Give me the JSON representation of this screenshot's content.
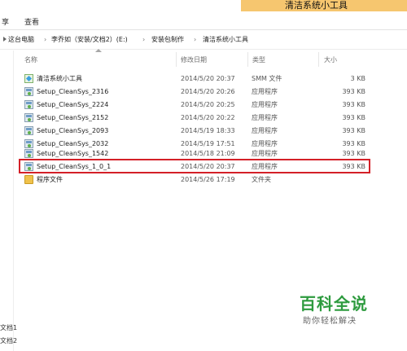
{
  "window": {
    "title": "清洁系统小工具"
  },
  "ribbon": {
    "tabs": [
      "享",
      "查看"
    ]
  },
  "breadcrumb": [
    "这台电脑",
    "李乔如（安装/文档2）(E:)",
    "安装包制作",
    "清洁系统小工具"
  ],
  "columns": {
    "name": "名称",
    "date": "修改日期",
    "type": "类型",
    "size": "大小"
  },
  "files": [
    {
      "name": "清洁系统小工具",
      "date": "2014/5/20 20:37",
      "type": "SMM 文件",
      "size": "3 KB",
      "icon": "smm-file-icon"
    },
    {
      "name": "Setup_CleanSys_2316",
      "date": "2014/5/20 20:26",
      "type": "应用程序",
      "size": "393 KB",
      "icon": "exe-icon"
    },
    {
      "name": "Setup_CleanSys_2224",
      "date": "2014/5/20 20:25",
      "type": "应用程序",
      "size": "393 KB",
      "icon": "exe-icon"
    },
    {
      "name": "Setup_CleanSys_2152",
      "date": "2014/5/20 20:22",
      "type": "应用程序",
      "size": "393 KB",
      "icon": "exe-icon"
    },
    {
      "name": "Setup_CleanSys_2093",
      "date": "2014/5/19 18:33",
      "type": "应用程序",
      "size": "393 KB",
      "icon": "exe-icon"
    },
    {
      "name": "Setup_CleanSys_2032",
      "date": "2014/5/19 17:51",
      "type": "应用程序",
      "size": "393 KB",
      "icon": "exe-icon"
    },
    {
      "name": "Setup_CleanSys_1542",
      "date": "2014/5/18 21:09",
      "type": "应用程序",
      "size": "393 KB",
      "icon": "exe-icon"
    },
    {
      "name": "Setup_CleanSys_1_0_1",
      "date": "2014/5/20 20:37",
      "type": "应用程序",
      "size": "393 KB",
      "icon": "exe-icon",
      "highlighted": true
    },
    {
      "name": "程序文件",
      "date": "2014/5/26 17:19",
      "type": "文件夹",
      "size": "",
      "icon": "folder-icon"
    }
  ],
  "left_pane_fragments": [
    "文档1",
    "文档2"
  ],
  "watermark": {
    "main": "百科全说",
    "sub": "助你轻松解决"
  },
  "colors": {
    "title_accent": "#f6c66f",
    "highlight_border": "#d42028",
    "watermark_green": "#2e9b3f"
  }
}
